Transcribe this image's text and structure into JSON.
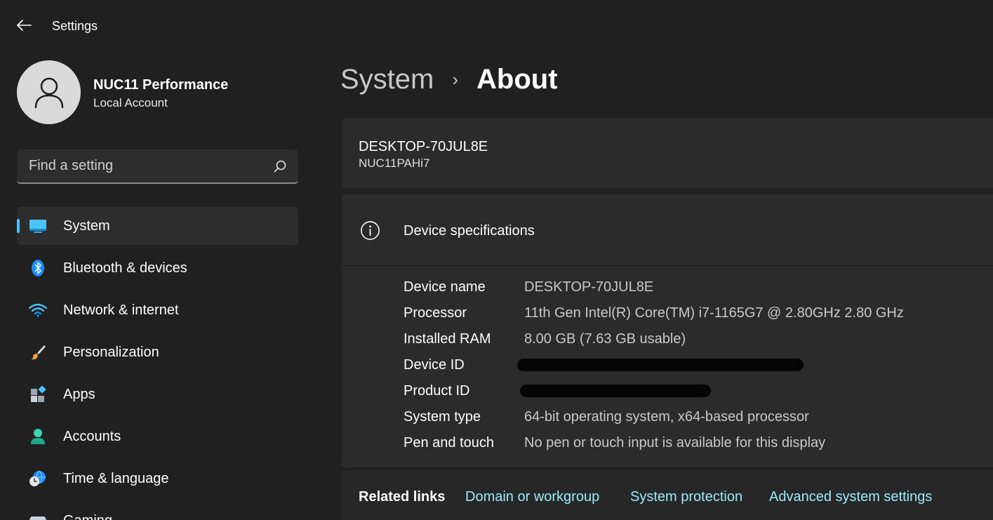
{
  "titlebar": {
    "title": "Settings"
  },
  "profile": {
    "name": "NUC11 Performance",
    "account_type": "Local Account"
  },
  "search": {
    "placeholder": "Find a setting"
  },
  "nav": {
    "items": [
      {
        "label": "System",
        "icon": "monitor-icon",
        "active": true
      },
      {
        "label": "Bluetooth & devices",
        "icon": "bluetooth-icon"
      },
      {
        "label": "Network & internet",
        "icon": "wifi-icon"
      },
      {
        "label": "Personalization",
        "icon": "brush-icon"
      },
      {
        "label": "Apps",
        "icon": "apps-icon"
      },
      {
        "label": "Accounts",
        "icon": "person-icon"
      },
      {
        "label": "Time & language",
        "icon": "clock-globe-icon"
      },
      {
        "label": "Gaming",
        "icon": "gamepad-icon"
      }
    ]
  },
  "breadcrumb": {
    "parent": "System",
    "separator": "›",
    "current": "About"
  },
  "device": {
    "name": "DESKTOP-70JUL8E",
    "model": "NUC11PAHi7"
  },
  "specs": {
    "title": "Device specifications",
    "rows": [
      {
        "label": "Device name",
        "value": "DESKTOP-70JUL8E"
      },
      {
        "label": "Processor",
        "value": "11th Gen Intel(R) Core(TM) i7-1165G7 @ 2.80GHz   2.80 GHz"
      },
      {
        "label": "Installed RAM",
        "value": "8.00 GB (7.63 GB usable)"
      },
      {
        "label": "Device ID",
        "value": ""
      },
      {
        "label": "Product ID",
        "value": ""
      },
      {
        "label": "System type",
        "value": "64-bit operating system, x64-based processor"
      },
      {
        "label": "Pen and touch",
        "value": "No pen or touch input is available for this display"
      }
    ]
  },
  "related": {
    "label": "Related links",
    "links": [
      "Domain or workgroup",
      "System protection",
      "Advanced system settings"
    ]
  },
  "colors": {
    "accent": "#4cc2ff",
    "link": "#99ebff",
    "background": "#202020",
    "card": "#2b2b2b"
  }
}
